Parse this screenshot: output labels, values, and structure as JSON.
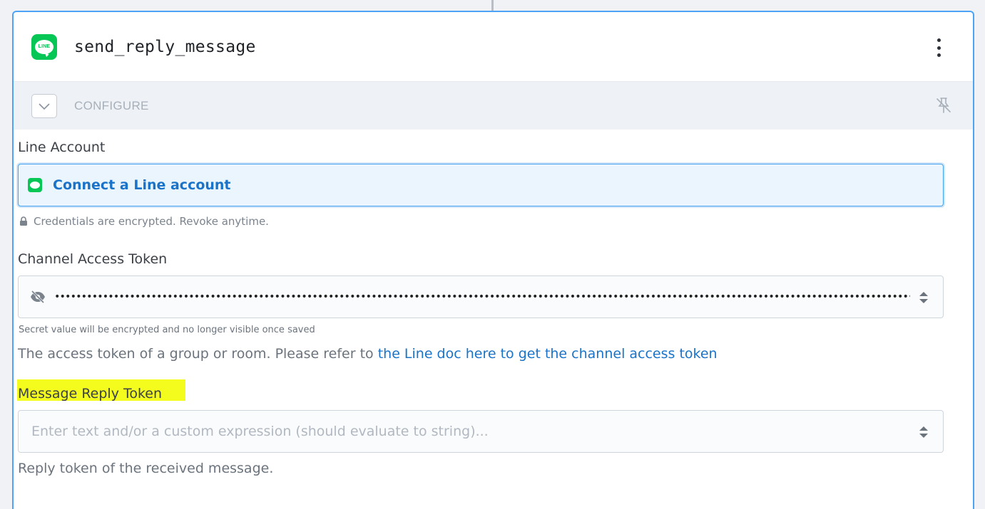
{
  "step": {
    "app_icon_text": "LINE",
    "name": "send_reply_message",
    "menu_icon": "kebab-menu-icon"
  },
  "configure": {
    "label": "CONFIGURE",
    "toggle_icon": "chevron-down-icon",
    "pin_icon": "unpin-icon"
  },
  "fields": {
    "line_account": {
      "label": "Line Account",
      "connect_label": "Connect a Line account",
      "note": "Credentials are encrypted. Revoke anytime."
    },
    "channel_access_token": {
      "label": "Channel Access Token",
      "masked_value": "••••••••••••••••••••••••••••••••••••••••••••••••••••••••••••••••••••••••••••••••••••••••••••••••••••••••••••••••••••••••••••••••••••••••••••••••••••••••••••••••••••••••••••••••••••••••••••••",
      "secret_note": "Secret value will be encrypted and no longer visible once saved",
      "description": "The access token of a group or room. Please refer to ",
      "doc_link": "the Line doc here to get the channel access token"
    },
    "message_reply_token": {
      "label": "Message Reply Token",
      "placeholder": "Enter text and/or a custom expression (should evaluate to string)...",
      "value": "",
      "description": "Reply token of the received message."
    }
  },
  "colors": {
    "accent_border": "#4da3f5",
    "line_green": "#06c755",
    "link": "#1a73c8",
    "highlight": "#f4fc1d"
  }
}
